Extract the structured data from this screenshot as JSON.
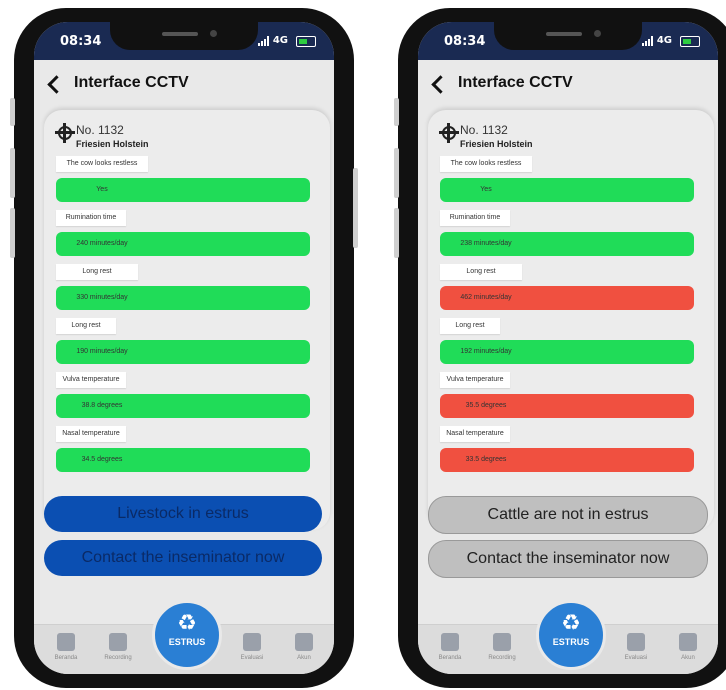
{
  "phones": [
    {
      "status": {
        "time": "08:34",
        "network": "4G"
      },
      "header": {
        "title": "Interface CCTV"
      },
      "cow": {
        "number": "No. 1132",
        "breed": "Friesien Holstein"
      },
      "metrics": [
        {
          "label": "The cow looks restless",
          "value": "Yes",
          "status_color": "#20dc58"
        },
        {
          "label": "Rumination time",
          "value": "240 minutes/day",
          "status_color": "#20dc58"
        },
        {
          "label": "Long rest",
          "value": "330 minutes/day",
          "status_color": "#20dc58"
        },
        {
          "label": "Long rest",
          "value": "190 minutes/day",
          "status_color": "#20dc58"
        },
        {
          "label": "Vulva temperature",
          "value": "38.8 degrees",
          "status_color": "#20dc58"
        },
        {
          "label": "Nasal temperature",
          "value": "34.5 degrees",
          "status_color": "#20dc58"
        }
      ],
      "result_button": "Livestock in estrus",
      "contact_button": "Contact the inseminator now",
      "nav": {
        "items": [
          {
            "label": "Beranda",
            "icon": "home-icon"
          },
          {
            "label": "Recording",
            "icon": "clipboard-icon"
          },
          {
            "label": "Evaluasi",
            "icon": "mail-icon"
          },
          {
            "label": "Akun",
            "icon": "account-icon"
          }
        ],
        "center_label": "ESTRUS",
        "center_icon": "recycle-icon"
      }
    },
    {
      "status": {
        "time": "08:34",
        "network": "4G"
      },
      "header": {
        "title": "Interface CCTV"
      },
      "cow": {
        "number": "No. 1132",
        "breed": "Friesien Holstein"
      },
      "metrics": [
        {
          "label": "The cow looks restless",
          "value": "Yes",
          "status_color": "#20dc58"
        },
        {
          "label": "Rumination time",
          "value": "238 minutes/day",
          "status_color": "#20dc58"
        },
        {
          "label": "Long rest",
          "value": "462 minutes/day",
          "status_color": "#f05040"
        },
        {
          "label": "Long rest",
          "value": "192 minutes/day",
          "status_color": "#20dc58"
        },
        {
          "label": "Vulva temperature",
          "value": "35.5 degrees",
          "status_color": "#f05040"
        },
        {
          "label": "Nasal temperature",
          "value": "33.5 degrees",
          "status_color": "#f05040"
        }
      ],
      "result_button": "Cattle are not in estrus",
      "contact_button": "Contact the inseminator now",
      "nav": {
        "items": [
          {
            "label": "Beranda",
            "icon": "home-icon"
          },
          {
            "label": "Recording",
            "icon": "clipboard-icon"
          },
          {
            "label": "Evaluasi",
            "icon": "mail-icon"
          },
          {
            "label": "Akun",
            "icon": "account-icon"
          }
        ],
        "center_label": "ESTRUS",
        "center_icon": "recycle-icon"
      }
    }
  ]
}
